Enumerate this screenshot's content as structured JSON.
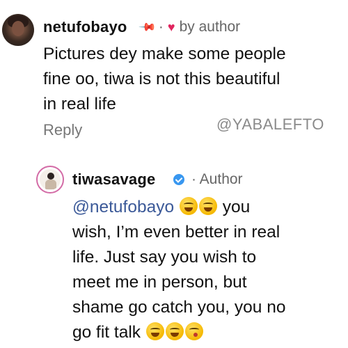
{
  "comment": {
    "username": "netufobayo",
    "liked_by": "by author",
    "text_lines": [
      "Pictures dey make some people",
      "fine oo, tiwa is not this beautiful",
      "in real life"
    ],
    "reply_label": "Reply"
  },
  "watermark": "@YABALEFTO",
  "reply": {
    "username": "tiwasavage",
    "role": "· Author",
    "mention": "@netufobayo",
    "line1_tail": "you",
    "text_lines": [
      "wish, I’m even better in real",
      "life. Just say you wish to",
      "meet me in person, but",
      "shame go catch you, you no",
      "go fit talk"
    ]
  },
  "icons": [
    "pin-icon",
    "heart-icon",
    "verified-badge-icon",
    "emoji-icon"
  ],
  "colors": {
    "heart": "#e0245e",
    "verified": "#3897f0",
    "mention": "#3b5998",
    "meta": "#666666"
  }
}
